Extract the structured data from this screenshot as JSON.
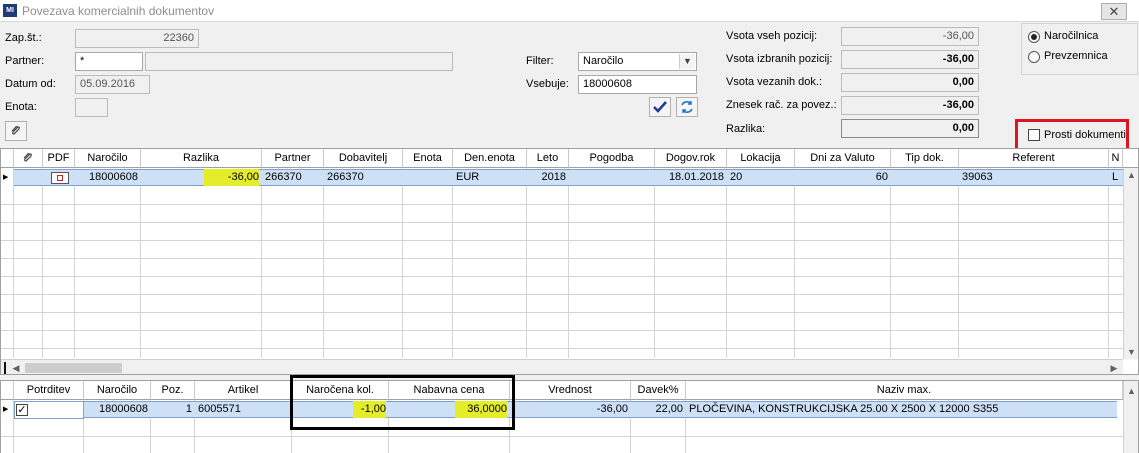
{
  "window": {
    "app_icon_text": "MI",
    "title": "Povezava komercialnih dokumentov",
    "close_symbol": "✕"
  },
  "form": {
    "zapst_label": "Zap.št.:",
    "zapst_value": "22360",
    "partner_label": "Partner:",
    "partner_value": "*",
    "partner_name_value": "",
    "datum_label": "Datum od:",
    "datum_value": "05.09.2016",
    "enota_label": "Enota:",
    "enota_value": "",
    "filter_label": "Filter:",
    "filter_value": "Naročilo",
    "vsebuje_label": "Vsebuje:",
    "vsebuje_value": "18000608"
  },
  "totals": {
    "vsota_vseh_label": "Vsota vseh pozicij:",
    "vsota_vseh_value": "-36,00",
    "vsota_izbranih_label": "Vsota izbranih pozicij:",
    "vsota_izbranih_value": "-36,00",
    "vsota_vezanih_label": "Vsota vezanih dok.:",
    "vsota_vezanih_value": "0,00",
    "znesek_label": "Znesek rač. za povez.:",
    "znesek_value": "-36,00",
    "razlika_label": "Razlika:",
    "razlika_value": "0,00"
  },
  "options": {
    "radio_narocilnica": "Naročilnica",
    "radio_prevzemnica": "Prevzemnica",
    "selected_radio": "Naročilnica",
    "prosti_dokumenti_label": "Prosti dokumenti",
    "prosti_dokumenti_checked": false
  },
  "icons": {
    "attach_icon": "paperclip-icon",
    "confirm_icon": "checkmark-icon",
    "refresh_icon": "refresh-icon",
    "pdf_icon": "pdf-icon",
    "row_pointer": "▶",
    "check_mark": "✓"
  },
  "top_grid": {
    "columns": [
      "",
      "PDF",
      "Naročilo",
      "Razlika",
      "Partner",
      "Dobavitelj",
      "Enota",
      "Den.enota",
      "Leto",
      "Pogodba",
      "Dogov.rok",
      "Lokacija",
      "Dni za Valuto",
      "Tip dok.",
      "Referent",
      "N"
    ],
    "rows": [
      {
        "narocilo": "18000608",
        "razlika": "-36,00",
        "partner": "266370",
        "dobavitelj": "266370",
        "enota": "",
        "den_enota": "EUR",
        "leto": "2018",
        "pogodba": "",
        "dogov_rok": "18.01.2018",
        "lokacija": "20",
        "dni_za_valuto": "60",
        "tip_dok": "",
        "referent": "39063",
        "n": "L"
      }
    ]
  },
  "bottom_grid": {
    "columns": [
      "Potrditev",
      "Naročilo",
      "Poz.",
      "Artikel",
      "Naročena kol.",
      "Nabavna cena",
      "Vrednost",
      "Davek%",
      "Naziv max."
    ],
    "rows": [
      {
        "potrditev": true,
        "narocilo": "18000608",
        "poz": "1",
        "artikel": "6005571",
        "narocena_kol": "-1,00",
        "nabavna_cena": "36,0000",
        "vrednost": "-36,00",
        "davek": "22,00",
        "naziv": "PLOČEVINA, KONSTRUKCIJSKA  25.00 X 2500 X 12000 S355"
      }
    ]
  },
  "colors": {
    "highlight": "#e5ec2a",
    "selected_row": "#cde0f5",
    "red_annotation": "#e0141e",
    "black_annotation": "#000000"
  }
}
